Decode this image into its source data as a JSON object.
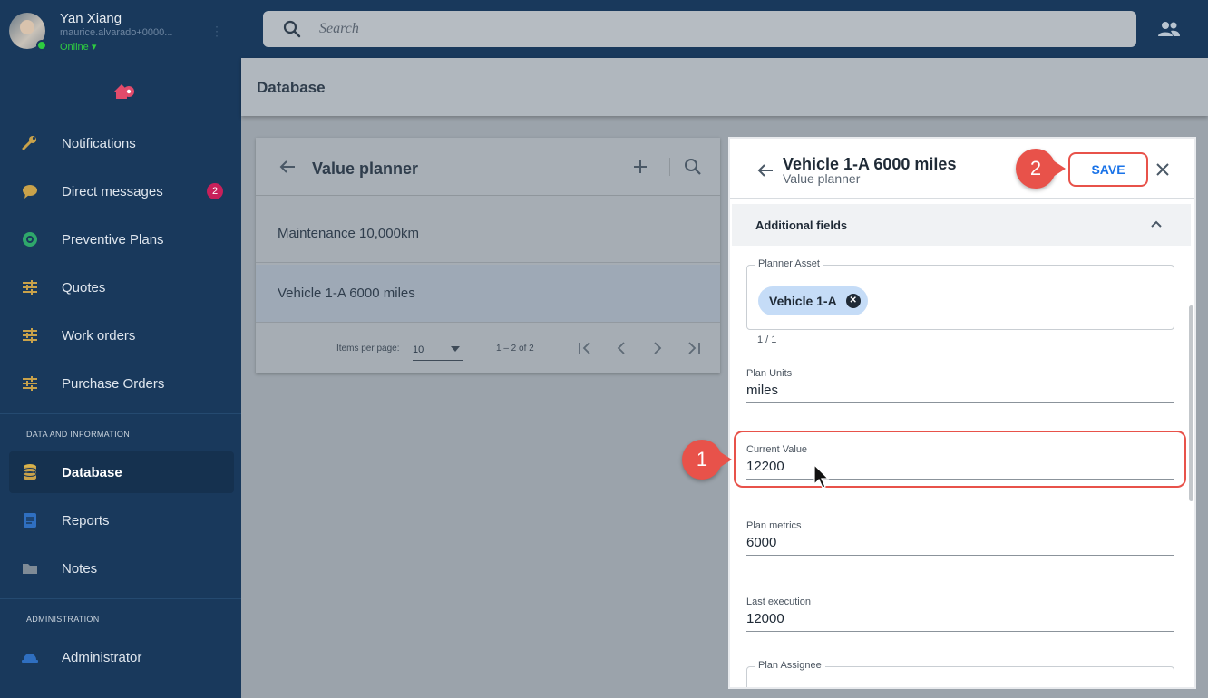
{
  "user": {
    "name": "Yan Xiang",
    "email": "maurice.alvarado+0000...",
    "status": "Online ▾"
  },
  "search": {
    "placeholder": "Search"
  },
  "nav": {
    "items": [
      {
        "label": "Notifications"
      },
      {
        "label": "Direct messages",
        "badge": "2"
      },
      {
        "label": "Preventive Plans"
      },
      {
        "label": "Quotes"
      },
      {
        "label": "Work orders"
      },
      {
        "label": "Purchase Orders"
      }
    ],
    "section_data": "DATA AND INFORMATION",
    "data_items": [
      {
        "label": "Database"
      },
      {
        "label": "Reports"
      },
      {
        "label": "Notes"
      }
    ],
    "section_admin": "ADMINISTRATION",
    "admin_items": [
      {
        "label": "Administrator"
      }
    ]
  },
  "page": {
    "title": "Database"
  },
  "list": {
    "title": "Value planner",
    "rows": [
      "Maintenance 10,000km",
      "Vehicle 1-A 6000 miles"
    ],
    "items_per_page_label": "Items per page:",
    "items_per_page": "10",
    "range": "1 – 2 of 2"
  },
  "detail": {
    "title": "Vehicle 1-A 6000 miles",
    "subtitle": "Value planner",
    "save_label": "SAVE",
    "section": "Additional fields",
    "planner_asset_label": "Planner Asset",
    "planner_asset_chip": "Vehicle 1-A",
    "counter": "1 / 1",
    "fields": [
      {
        "label": "Plan Units",
        "value": "miles"
      },
      {
        "label": "Current Value",
        "value": "12200"
      },
      {
        "label": "Plan metrics",
        "value": "6000"
      },
      {
        "label": "Last execution",
        "value": "12000"
      }
    ],
    "assignee_label": "Plan Assignee"
  },
  "steps": {
    "one": "1",
    "two": "2"
  },
  "colors": {
    "accent": "#e8524a",
    "link": "#1a73e8",
    "sidebar": "#19395c"
  }
}
